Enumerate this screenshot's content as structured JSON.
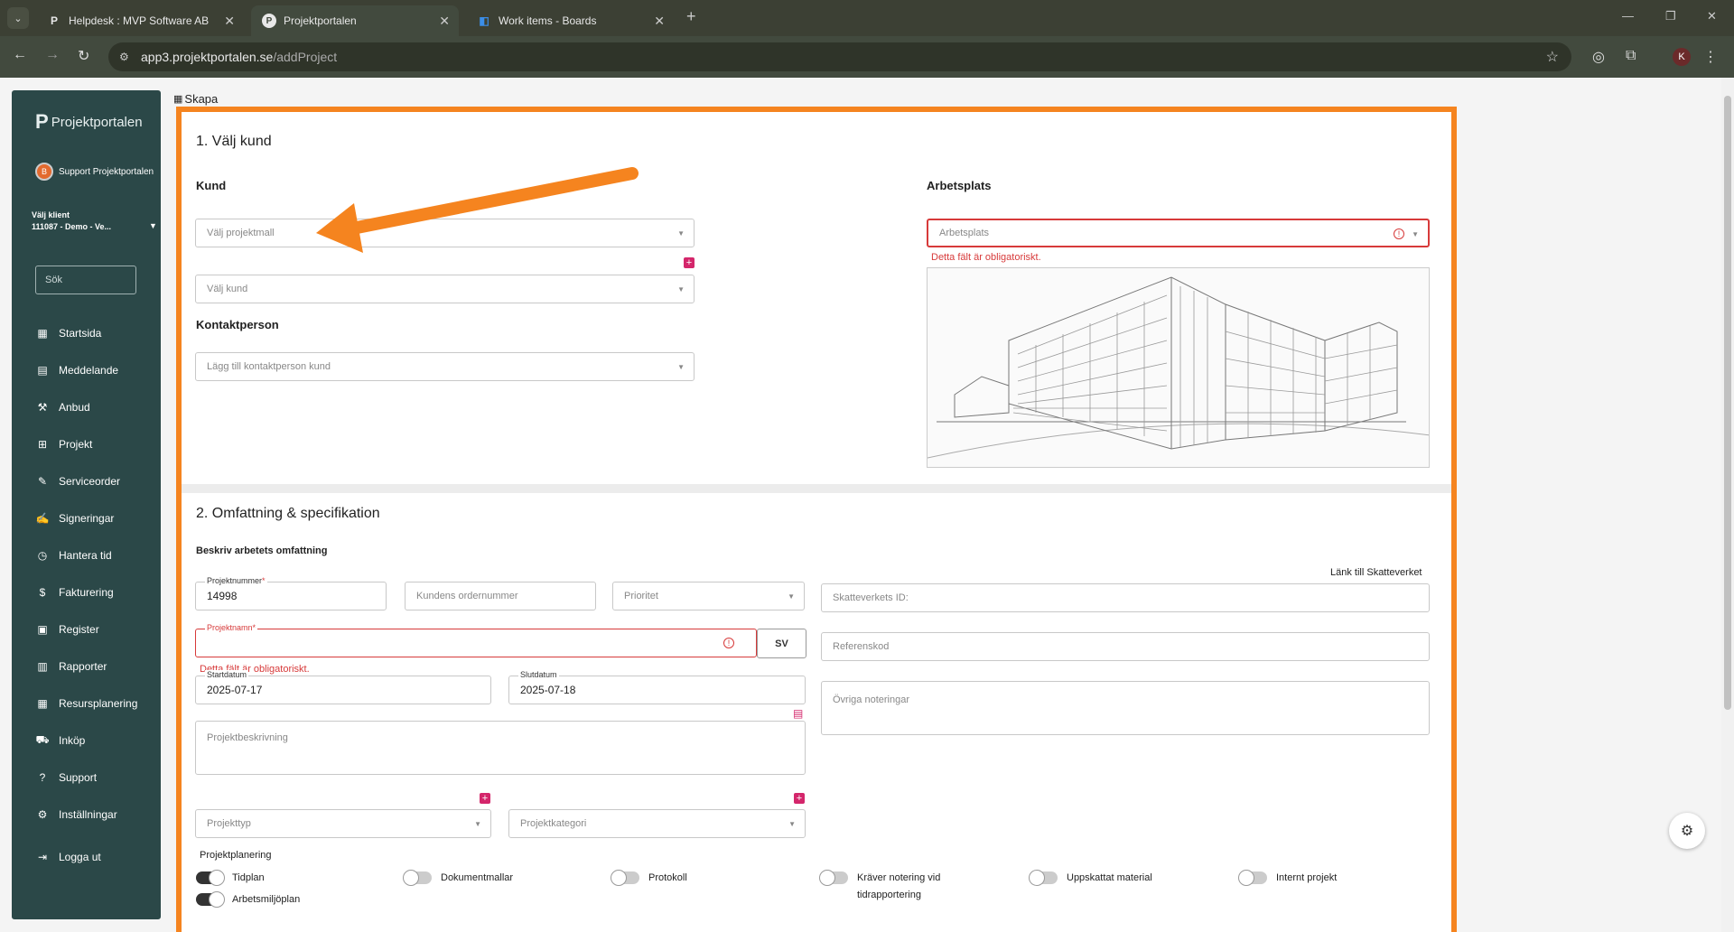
{
  "browser": {
    "tabs": [
      {
        "label": "Helpdesk : MVP Software AB",
        "favicon": "P"
      },
      {
        "label": "Projektportalen",
        "favicon": "P"
      },
      {
        "label": "Work items - Boards",
        "favicon": "azure-boards-icon"
      }
    ],
    "url_host": "app3.projektportalen.se",
    "url_path": "/addProject",
    "profile_initial": "K"
  },
  "sidebar": {
    "logo": "Projektportalen",
    "user": {
      "initial": "B",
      "name": "Support Projektportalen"
    },
    "client_label": "Välj klient",
    "client_value": "111087 - Demo - Ve...",
    "search_placeholder": "Sök",
    "items": [
      {
        "label": "Startsida",
        "icon": "dashboard-icon"
      },
      {
        "label": "Meddelande",
        "icon": "message-icon"
      },
      {
        "label": "Anbud",
        "icon": "gavel-icon"
      },
      {
        "label": "Projekt",
        "icon": "grid-icon"
      },
      {
        "label": "Serviceorder",
        "icon": "wrench-icon"
      },
      {
        "label": "Signeringar",
        "icon": "signature-icon"
      },
      {
        "label": "Hantera tid",
        "icon": "clock-icon"
      },
      {
        "label": "Fakturering",
        "icon": "dollar-icon"
      },
      {
        "label": "Register",
        "icon": "register-icon"
      },
      {
        "label": "Rapporter",
        "icon": "report-icon"
      },
      {
        "label": "Resursplanering",
        "icon": "calendar-icon"
      },
      {
        "label": "Inköp",
        "icon": "cart-icon"
      },
      {
        "label": "Support",
        "icon": "help-icon"
      },
      {
        "label": "Inställningar",
        "icon": "gear-icon"
      }
    ],
    "logout": "Logga ut"
  },
  "breadcrumb": "Skapa",
  "section1": {
    "title": "1. Välj kund",
    "kund_label": "Kund",
    "projektmall_placeholder": "Välj projektmall",
    "kund_placeholder": "Välj kund",
    "kontaktperson_label": "Kontaktperson",
    "kontaktperson_placeholder": "Lägg till kontaktperson kund",
    "arbetsplats_label": "Arbetsplats",
    "arbetsplats_placeholder": "Arbetsplats",
    "arbetsplats_error": "Detta fält är obligatoriskt."
  },
  "section2": {
    "title": "2. Omfattning & specifikation",
    "subtitle": "Beskriv arbetets omfattning",
    "projektnummer_label": "Projektnummer",
    "projektnummer_value": "14998",
    "kundens_ordernummer_placeholder": "Kundens ordernummer",
    "prioritet_placeholder": "Prioritet",
    "skatteverket_link": "Länk till Skatteverket",
    "skatteverket_placeholder": "Skatteverkets ID:",
    "projektnamn_label": "Projektnamn",
    "projektnamn_error": "Detta fält är obligatoriskt.",
    "lang_button": "SV",
    "referenskod_placeholder": "Referenskod",
    "startdatum_label": "Startdatum",
    "startdatum_value": "2025-07-17",
    "slutdatum_label": "Slutdatum",
    "slutdatum_value": "2025-07-18",
    "ovriga_noteringar_placeholder": "Övriga noteringar",
    "projektbeskrivning_placeholder": "Projektbeskrivning",
    "projekttyp_placeholder": "Projekttyp",
    "projektkategori_placeholder": "Projektkategori",
    "planering_label": "Projektplanering",
    "toggles": [
      {
        "label": "Tidplan",
        "on": true
      },
      {
        "label": "Arbetsmiljöplan",
        "on": true
      },
      {
        "label": "Dokumentmallar",
        "on": false
      },
      {
        "label": "Protokoll",
        "on": false
      },
      {
        "label": "Kräver notering vid tidrapportering",
        "on": false
      },
      {
        "label": "Uppskattat material",
        "on": false
      },
      {
        "label": "Internt projekt",
        "on": false
      }
    ]
  },
  "colors": {
    "sidebar_bg": "#2b4848",
    "highlight_frame": "#f5841f",
    "error_red": "#d73a3a",
    "plus_pink": "#d4266b"
  }
}
